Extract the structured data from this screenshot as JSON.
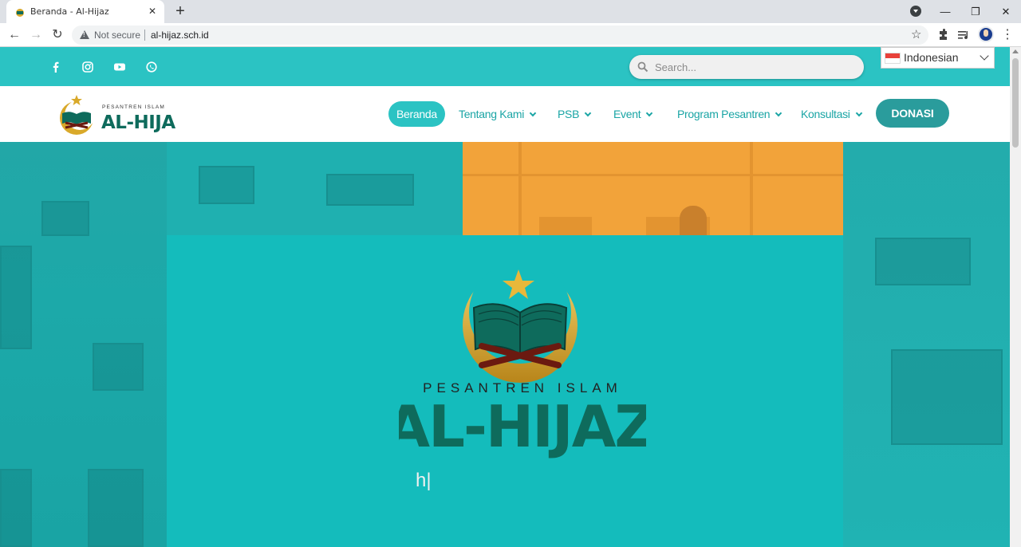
{
  "browser": {
    "tab_title": "Beranda - Al-Hijaz",
    "tab_close": "✕",
    "new_tab": "+",
    "not_secure": "Not secure",
    "url": "al-hijaz.sch.id",
    "window_minimize": "—",
    "window_restore": "❐",
    "window_close": "✕"
  },
  "topbar": {
    "social": [
      "facebook-icon",
      "instagram-icon",
      "youtube-icon",
      "whatsapp-icon"
    ],
    "search_placeholder": "Search...",
    "language": "Indonesian"
  },
  "nav": {
    "items": [
      {
        "label": "Beranda",
        "active": true
      },
      {
        "label": "Tentang Kami",
        "dropdown": true
      },
      {
        "label": "PSB",
        "dropdown": true
      },
      {
        "label": "Event",
        "dropdown": true
      },
      {
        "label": "Program Pesantren",
        "dropdown": true
      },
      {
        "label": "Konsultasi",
        "dropdown": true
      }
    ],
    "donate": "DONASI"
  },
  "logo": {
    "subtitle": "PESANTREN ISLAM",
    "title": "AL-HIJAZ"
  },
  "hero": {
    "logo_subtitle": "PESANTREN ISLAM",
    "logo_title": "AL-HIJAZ",
    "typed_text": "h|"
  },
  "colors": {
    "brand_teal": "#2bc3c3",
    "nav_text": "#1aa5a5",
    "donate_bg": "#2a9c9c",
    "logo_green": "#0e6b5c",
    "gold": "#d9a92a"
  }
}
